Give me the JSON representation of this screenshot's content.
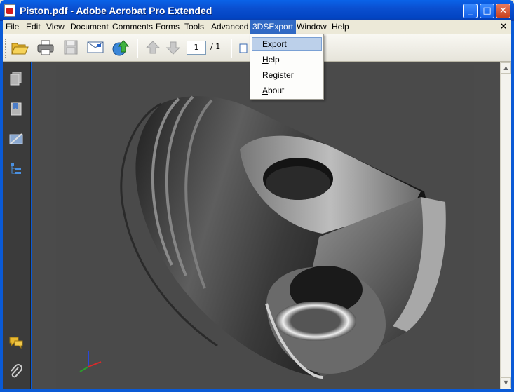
{
  "window": {
    "title": "Piston.pdf - Adobe Acrobat Pro Extended",
    "controls": {
      "minimize": "_",
      "maximize": "□",
      "close": "✕"
    }
  },
  "menubar": {
    "items": [
      {
        "label": "File"
      },
      {
        "label": "Edit"
      },
      {
        "label": "View"
      },
      {
        "label": "Document"
      },
      {
        "label": "Comments"
      },
      {
        "label": "Forms"
      },
      {
        "label": "Tools"
      },
      {
        "label": "Advanced"
      },
      {
        "label": "3DSExport",
        "active": true
      },
      {
        "label": "Window"
      },
      {
        "label": "Help"
      }
    ],
    "close_glyph": "×"
  },
  "toolbar": {
    "page_current": "1",
    "page_total": "/ 1",
    "icons": [
      "open-folder-icon",
      "print-icon",
      "save-icon",
      "email-icon",
      "upload-icon",
      "previous-page-icon",
      "next-page-icon"
    ]
  },
  "menu_3dsexport": {
    "items": [
      {
        "mnemonic": "E",
        "rest": "xport",
        "highlighted": true
      },
      {
        "mnemonic": "H",
        "rest": "elp"
      },
      {
        "mnemonic": "R",
        "rest": "egister"
      },
      {
        "mnemonic": "A",
        "rest": "bout"
      }
    ]
  },
  "leftnav": {
    "icons": [
      "pages-icon",
      "bookmarks-icon",
      "signatures-icon",
      "model-tree-icon",
      "comments-icon",
      "attachments-icon"
    ]
  },
  "colors": {
    "title_blue": "#0a4fd0",
    "menu_highlight": "#316ac5",
    "dropdown_highlight": "#bcd0ea",
    "viewport_bg": "#4a4a4a"
  }
}
